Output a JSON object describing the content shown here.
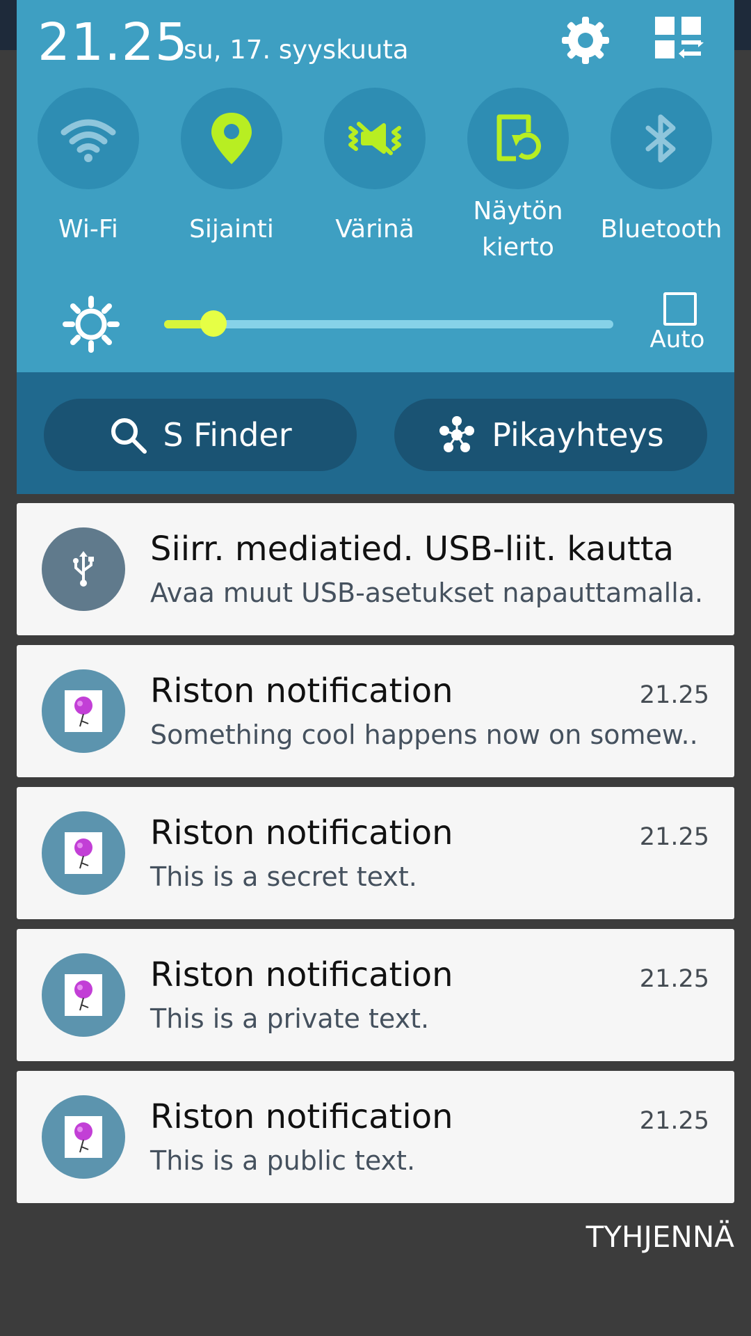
{
  "header": {
    "time": "21.25",
    "date": "su, 17. syyskuuta"
  },
  "toggles": [
    {
      "label": "Wi-Fi",
      "icon": "wifi-icon",
      "active": false
    },
    {
      "label": "Sijainti",
      "icon": "location-pin-icon",
      "active": true
    },
    {
      "label": "Värinä",
      "icon": "vibrate-icon",
      "active": true
    },
    {
      "label": "Näytön kierto",
      "icon": "screen-rotation-icon",
      "active": true
    },
    {
      "label": "Bluetooth",
      "icon": "bluetooth-icon",
      "active": false
    }
  ],
  "brightness": {
    "level_fraction": 0.11,
    "auto_label": "Auto",
    "auto_checked": false
  },
  "buttons": {
    "s_finder": "S Finder",
    "quick_connect": "Pikayhteys"
  },
  "notifications": [
    {
      "title": "Siirr. mediatied. USB-liit. kautta",
      "text": "Avaa muut USB-asetukset napauttamalla.",
      "time": "",
      "icon": "usb-icon"
    },
    {
      "title": "Riston notification",
      "text": "Something cool happens now on somew..",
      "time": "21.25",
      "icon": "app-thumbnail"
    },
    {
      "title": "Riston notification",
      "text": "This is a secret text.",
      "time": "21.25",
      "icon": "app-thumbnail"
    },
    {
      "title": "Riston notification",
      "text": "This is a private text.",
      "time": "21.25",
      "icon": "app-thumbnail"
    },
    {
      "title": "Riston notification",
      "text": "This is a public text.",
      "time": "21.25",
      "icon": "app-thumbnail"
    }
  ],
  "clear_label": "TYHJENNÄ",
  "colors": {
    "panel": "#3e9fc2",
    "toggle_bg": "#2e8db3",
    "active_icon": "#b8ee22",
    "inactive_icon": "#8fc6dc",
    "finder_band": "#20698e",
    "pill": "#1a5373",
    "card": "#f6f6f6",
    "shade": "#3c3c3c"
  }
}
